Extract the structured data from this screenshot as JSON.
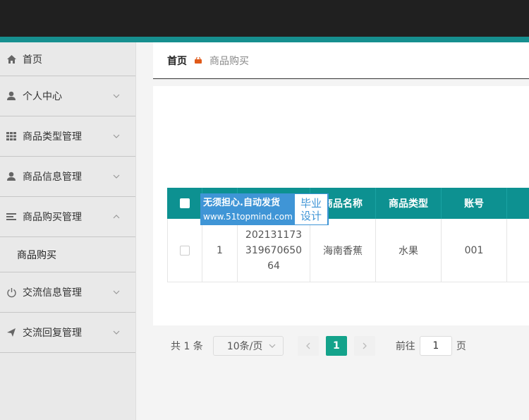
{
  "sidebar": {
    "items": [
      {
        "label": "首页",
        "icon": "home-icon"
      },
      {
        "label": "个人中心",
        "icon": "user-icon"
      },
      {
        "label": "商品类型管理",
        "icon": "grid-icon"
      },
      {
        "label": "商品信息管理",
        "icon": "user-icon"
      },
      {
        "label": "商品购买管理",
        "icon": "list-icon"
      },
      {
        "label": "交流信息管理",
        "icon": "power-icon"
      },
      {
        "label": "交流回复管理",
        "icon": "send-icon"
      }
    ],
    "submenu_label": "商品购买"
  },
  "breadcrumb": {
    "home": "首页",
    "current": "商品购买"
  },
  "table": {
    "headers": [
      "",
      "",
      "",
      "商品名称",
      "商品类型",
      "账号"
    ],
    "row": {
      "index": "1",
      "code": "202131173\n319670650\n64",
      "name": "海南香蕉",
      "type": "水果",
      "account": "001"
    }
  },
  "watermark": {
    "line1": "无须担心.自动发货",
    "line2": "www.51topmind.com",
    "badge1": "毕业",
    "badge2": "设计"
  },
  "pager": {
    "total": "共 1 条",
    "page_size": "10条/页",
    "current_page": "1",
    "goto_label": "前往",
    "goto_value": "1",
    "page_suffix": "页"
  },
  "colors": {
    "accent": "#0d9191",
    "topbar": "#202020",
    "page_active": "#14a38b",
    "watermark": "#3f95d6"
  }
}
